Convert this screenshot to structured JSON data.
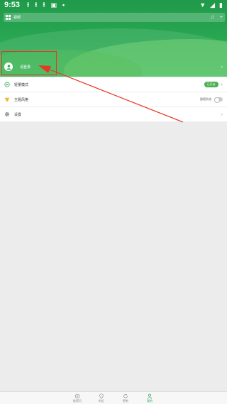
{
  "status_bar": {
    "time": "9:53",
    "left_icons": [
      "download-icon",
      "download-icon",
      "download-icon",
      "app-icon",
      "dot-icon"
    ],
    "right_icons": [
      "wifi-icon",
      "signal-icon",
      "battery-icon"
    ]
  },
  "header": {
    "title": "视频",
    "right_icons": [
      "bell-icon",
      "plus-icon"
    ]
  },
  "user": {
    "name": "请登录"
  },
  "menu": [
    {
      "icon": "play-circle-icon",
      "label": "轻量模式",
      "badge": "已开启",
      "control": "chevron"
    },
    {
      "icon": "shirt-icon",
      "label": "主题风格",
      "toggle_text": "跟随系统",
      "control": "toggle"
    },
    {
      "icon": "gear-icon",
      "label": "设置",
      "control": "chevron"
    }
  ],
  "tabbar": [
    {
      "icon": "gamepad-icon",
      "label": "推荐页"
    },
    {
      "icon": "location-icon",
      "label": "附近"
    },
    {
      "icon": "refresh-icon",
      "label": "更新"
    },
    {
      "icon": "person-icon",
      "label": "我的",
      "active": true
    }
  ],
  "colors": {
    "accent": "#2ba953",
    "annotation": "#e53925"
  }
}
